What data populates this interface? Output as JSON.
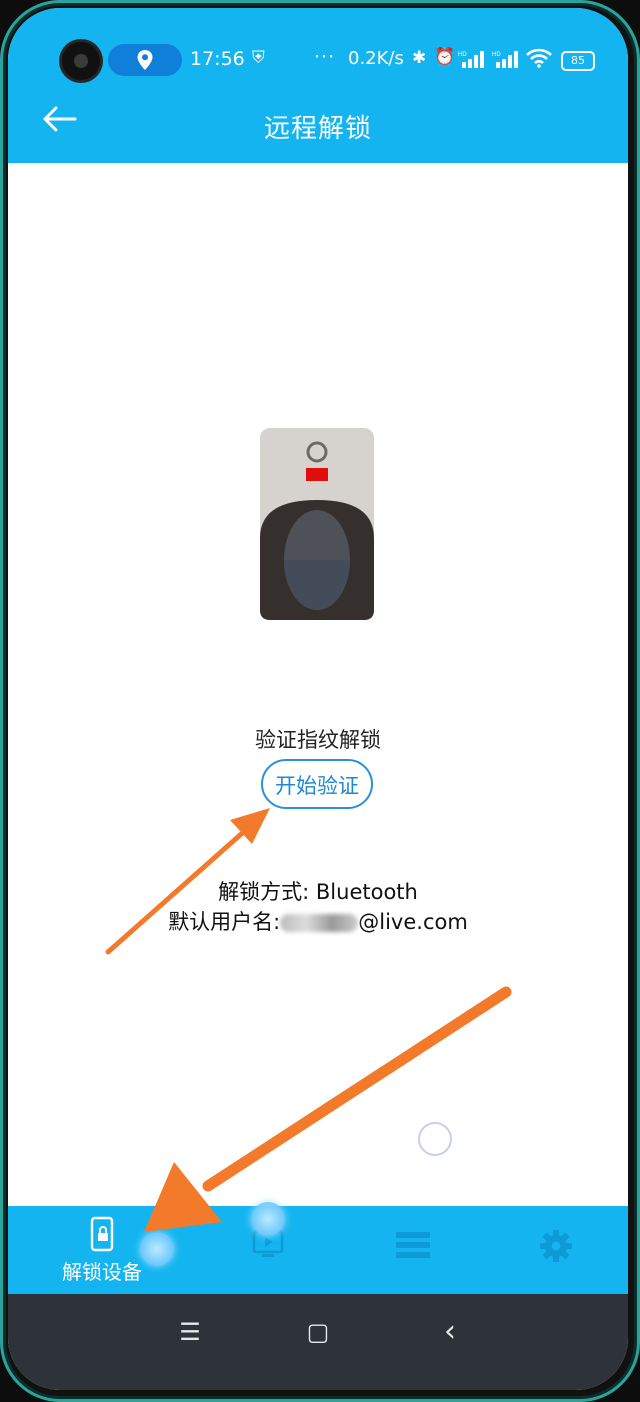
{
  "status_bar": {
    "time": "17:56",
    "dots": "···",
    "net_speed": "0.2K/s",
    "signal1": "HD",
    "signal2": "HD",
    "battery": "85"
  },
  "header": {
    "title": "远程解锁"
  },
  "main": {
    "verify_label": "验证指纹解锁",
    "start_button": "开始验证",
    "method_line": "解锁方式: Bluetooth",
    "user_prefix": "默认用户名:",
    "user_suffix": "@live.com"
  },
  "bottom_nav": {
    "items": [
      {
        "label": "解锁设备",
        "icon": "phone-lock-icon",
        "active": true
      },
      {
        "label": "",
        "icon": "screen-icon",
        "active": false
      },
      {
        "label": "",
        "icon": "list-icon",
        "active": false
      },
      {
        "label": "",
        "icon": "gear-icon",
        "active": false
      }
    ]
  },
  "system_nav": {
    "menu": "☰",
    "home": "▢",
    "back": "‹"
  },
  "colors": {
    "brand": "#13b4ef",
    "button_border": "#2d8fd6",
    "arrow": "#f37a2a"
  }
}
